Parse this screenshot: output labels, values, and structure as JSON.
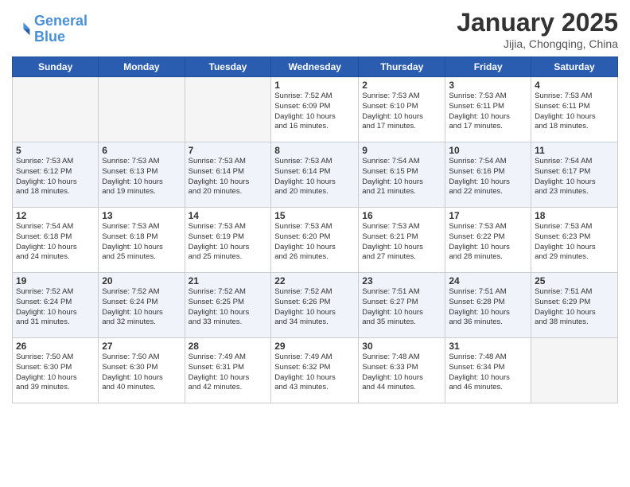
{
  "header": {
    "logo_line1": "General",
    "logo_line2": "Blue",
    "month": "January 2025",
    "location": "Jijia, Chongqing, China"
  },
  "days_of_week": [
    "Sunday",
    "Monday",
    "Tuesday",
    "Wednesday",
    "Thursday",
    "Friday",
    "Saturday"
  ],
  "weeks": [
    [
      {
        "day": "",
        "info": ""
      },
      {
        "day": "",
        "info": ""
      },
      {
        "day": "",
        "info": ""
      },
      {
        "day": "1",
        "info": "Sunrise: 7:52 AM\nSunset: 6:09 PM\nDaylight: 10 hours\nand 16 minutes."
      },
      {
        "day": "2",
        "info": "Sunrise: 7:53 AM\nSunset: 6:10 PM\nDaylight: 10 hours\nand 17 minutes."
      },
      {
        "day": "3",
        "info": "Sunrise: 7:53 AM\nSunset: 6:11 PM\nDaylight: 10 hours\nand 17 minutes."
      },
      {
        "day": "4",
        "info": "Sunrise: 7:53 AM\nSunset: 6:11 PM\nDaylight: 10 hours\nand 18 minutes."
      }
    ],
    [
      {
        "day": "5",
        "info": "Sunrise: 7:53 AM\nSunset: 6:12 PM\nDaylight: 10 hours\nand 18 minutes."
      },
      {
        "day": "6",
        "info": "Sunrise: 7:53 AM\nSunset: 6:13 PM\nDaylight: 10 hours\nand 19 minutes."
      },
      {
        "day": "7",
        "info": "Sunrise: 7:53 AM\nSunset: 6:14 PM\nDaylight: 10 hours\nand 20 minutes."
      },
      {
        "day": "8",
        "info": "Sunrise: 7:53 AM\nSunset: 6:14 PM\nDaylight: 10 hours\nand 20 minutes."
      },
      {
        "day": "9",
        "info": "Sunrise: 7:54 AM\nSunset: 6:15 PM\nDaylight: 10 hours\nand 21 minutes."
      },
      {
        "day": "10",
        "info": "Sunrise: 7:54 AM\nSunset: 6:16 PM\nDaylight: 10 hours\nand 22 minutes."
      },
      {
        "day": "11",
        "info": "Sunrise: 7:54 AM\nSunset: 6:17 PM\nDaylight: 10 hours\nand 23 minutes."
      }
    ],
    [
      {
        "day": "12",
        "info": "Sunrise: 7:54 AM\nSunset: 6:18 PM\nDaylight: 10 hours\nand 24 minutes."
      },
      {
        "day": "13",
        "info": "Sunrise: 7:53 AM\nSunset: 6:18 PM\nDaylight: 10 hours\nand 25 minutes."
      },
      {
        "day": "14",
        "info": "Sunrise: 7:53 AM\nSunset: 6:19 PM\nDaylight: 10 hours\nand 25 minutes."
      },
      {
        "day": "15",
        "info": "Sunrise: 7:53 AM\nSunset: 6:20 PM\nDaylight: 10 hours\nand 26 minutes."
      },
      {
        "day": "16",
        "info": "Sunrise: 7:53 AM\nSunset: 6:21 PM\nDaylight: 10 hours\nand 27 minutes."
      },
      {
        "day": "17",
        "info": "Sunrise: 7:53 AM\nSunset: 6:22 PM\nDaylight: 10 hours\nand 28 minutes."
      },
      {
        "day": "18",
        "info": "Sunrise: 7:53 AM\nSunset: 6:23 PM\nDaylight: 10 hours\nand 29 minutes."
      }
    ],
    [
      {
        "day": "19",
        "info": "Sunrise: 7:52 AM\nSunset: 6:24 PM\nDaylight: 10 hours\nand 31 minutes."
      },
      {
        "day": "20",
        "info": "Sunrise: 7:52 AM\nSunset: 6:24 PM\nDaylight: 10 hours\nand 32 minutes."
      },
      {
        "day": "21",
        "info": "Sunrise: 7:52 AM\nSunset: 6:25 PM\nDaylight: 10 hours\nand 33 minutes."
      },
      {
        "day": "22",
        "info": "Sunrise: 7:52 AM\nSunset: 6:26 PM\nDaylight: 10 hours\nand 34 minutes."
      },
      {
        "day": "23",
        "info": "Sunrise: 7:51 AM\nSunset: 6:27 PM\nDaylight: 10 hours\nand 35 minutes."
      },
      {
        "day": "24",
        "info": "Sunrise: 7:51 AM\nSunset: 6:28 PM\nDaylight: 10 hours\nand 36 minutes."
      },
      {
        "day": "25",
        "info": "Sunrise: 7:51 AM\nSunset: 6:29 PM\nDaylight: 10 hours\nand 38 minutes."
      }
    ],
    [
      {
        "day": "26",
        "info": "Sunrise: 7:50 AM\nSunset: 6:30 PM\nDaylight: 10 hours\nand 39 minutes."
      },
      {
        "day": "27",
        "info": "Sunrise: 7:50 AM\nSunset: 6:30 PM\nDaylight: 10 hours\nand 40 minutes."
      },
      {
        "day": "28",
        "info": "Sunrise: 7:49 AM\nSunset: 6:31 PM\nDaylight: 10 hours\nand 42 minutes."
      },
      {
        "day": "29",
        "info": "Sunrise: 7:49 AM\nSunset: 6:32 PM\nDaylight: 10 hours\nand 43 minutes."
      },
      {
        "day": "30",
        "info": "Sunrise: 7:48 AM\nSunset: 6:33 PM\nDaylight: 10 hours\nand 44 minutes."
      },
      {
        "day": "31",
        "info": "Sunrise: 7:48 AM\nSunset: 6:34 PM\nDaylight: 10 hours\nand 46 minutes."
      },
      {
        "day": "",
        "info": ""
      }
    ]
  ]
}
